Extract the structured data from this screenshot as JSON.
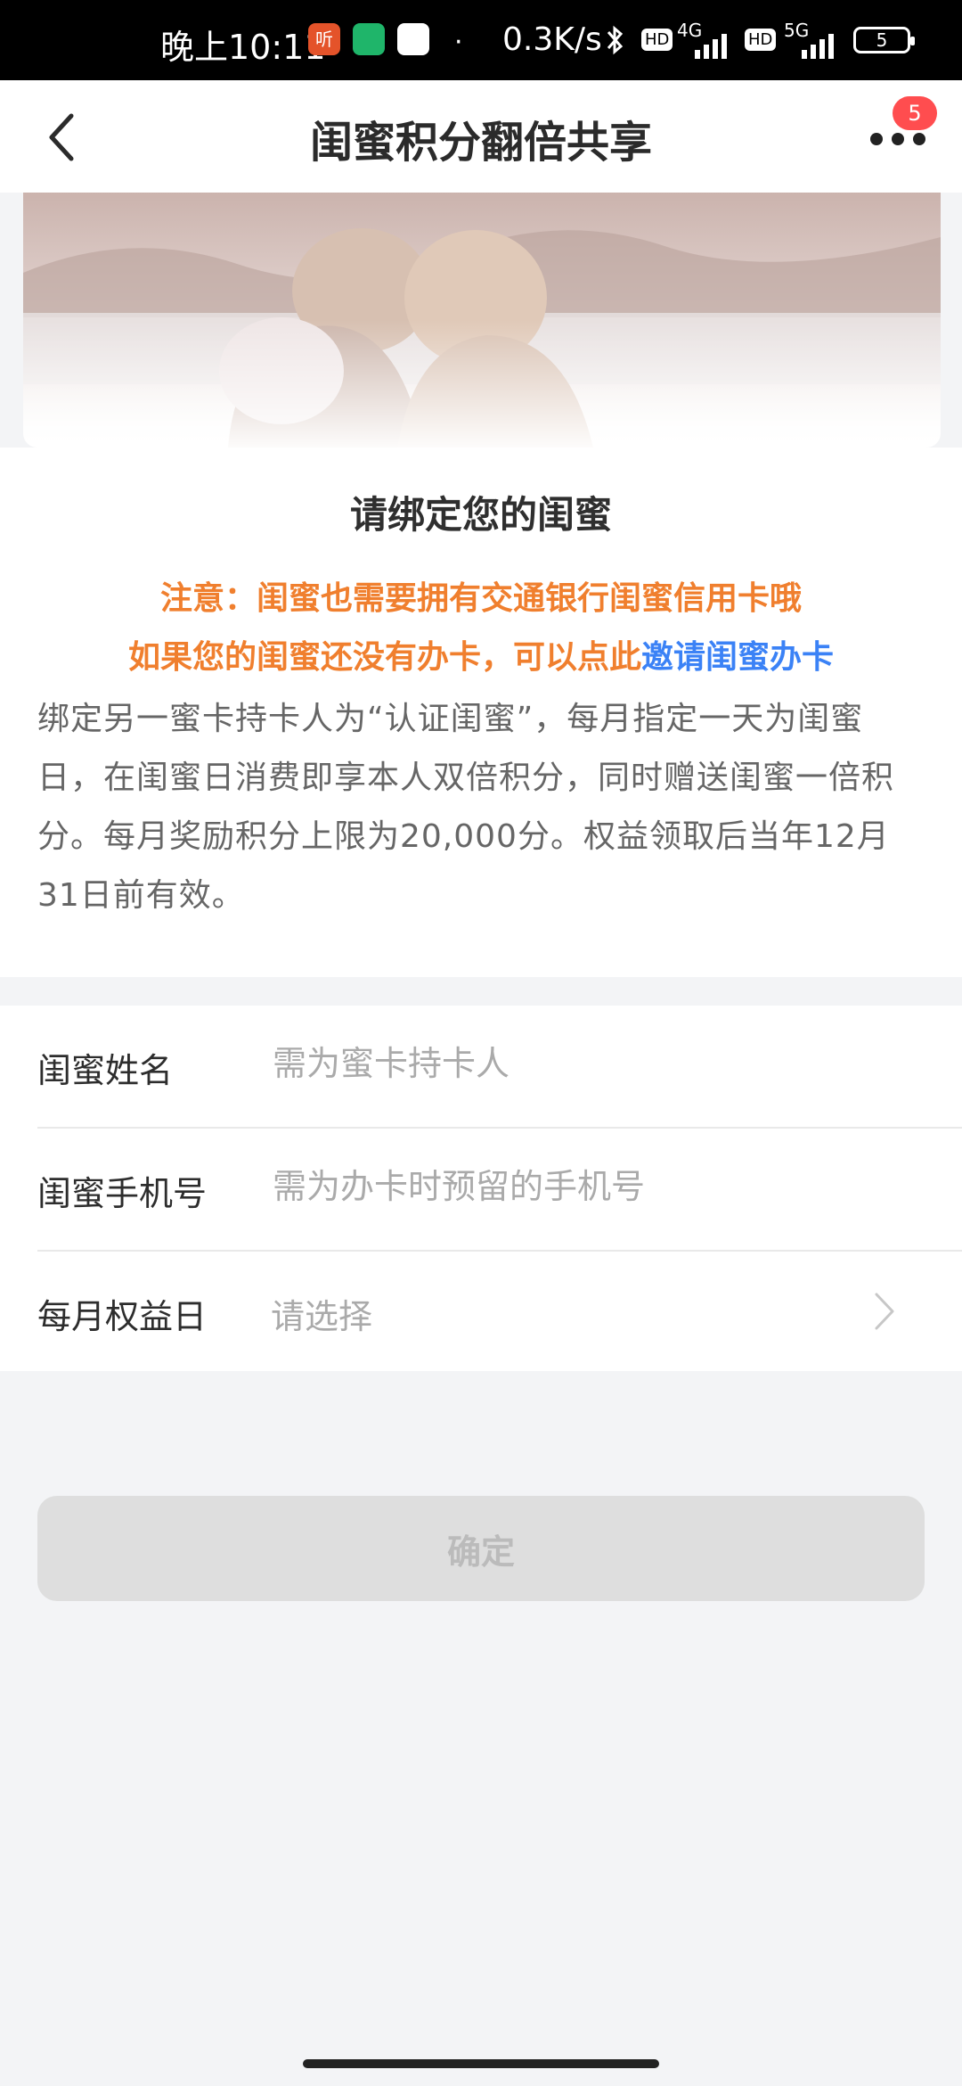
{
  "status_bar": {
    "time": "晚上10:11",
    "speed": "0.3K/s",
    "net1": "4G",
    "net2": "5G",
    "hd": "HD",
    "battery": "5"
  },
  "nav": {
    "title": "闺蜜积分翻倍共享",
    "badge": "5"
  },
  "info": {
    "title": "请绑定您的闺蜜",
    "note_line1": "注意：闺蜜也需要拥有交通银行闺蜜信用卡哦",
    "note_line2_prefix": "如果您的闺蜜还没有办卡，可以点此",
    "note_line2_link": "邀请闺蜜办卡",
    "description": "绑定另一蜜卡持卡人为“认证闺蜜”，每月指定一天为闺蜜日，在闺蜜日消费即享本人双倍积分，同时赠送闺蜜一倍积分。每月奖励积分上限为20,000分。权益领取后当年12月31日前有效。"
  },
  "form": {
    "name_label": "闺蜜姓名",
    "name_placeholder": "需为蜜卡持卡人",
    "phone_label": "闺蜜手机号",
    "phone_placeholder": "需为办卡时预留的手机号",
    "day_label": "每月权益日",
    "day_value": "请选择"
  },
  "confirm_label": "确定",
  "colors": {
    "accent_orange": "#f07f2e",
    "link_blue": "#3b82f6",
    "badge_red": "#ff4d4f"
  }
}
